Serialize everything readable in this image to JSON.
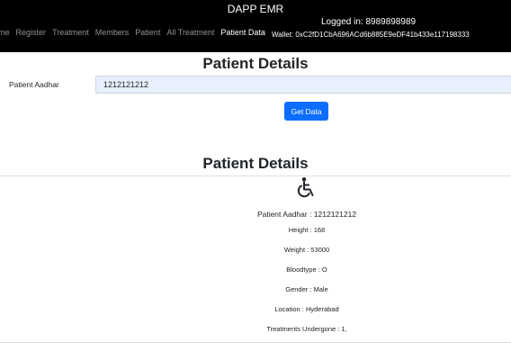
{
  "header": {
    "app_title": "DAPP EMR",
    "logged_in": "Logged in: 8989898989",
    "wallet": "Wallet: 0xC2fD1CbA696ACd6b885E9eDF41b433e117198333",
    "nav": [
      {
        "label": "me"
      },
      {
        "label": "Register"
      },
      {
        "label": "Treatment"
      },
      {
        "label": "Members"
      },
      {
        "label": "Patient"
      },
      {
        "label": "All Treatment"
      },
      {
        "label": "Patient Data",
        "active": true
      }
    ]
  },
  "search": {
    "title": "Patient Details",
    "field_label": "Patient Aadhar",
    "field_value": "1212121212",
    "button_label": "Get Data"
  },
  "result": {
    "title": "Patient Details",
    "icon": "wheelchair-icon",
    "aadhar_line": "Patient Aadhar : 1212121212",
    "height": "Height : 168",
    "weight": "Weight : 53000",
    "bloodtype": "Bloodtype : O",
    "gender": "Gender : Male",
    "location": "Location : Hyderabad",
    "treatments": "Treatments Undergone : 1,"
  },
  "colors": {
    "header_bg": "#000000",
    "button_bg": "#0d6efd",
    "input_bg": "#e8f0fe"
  }
}
